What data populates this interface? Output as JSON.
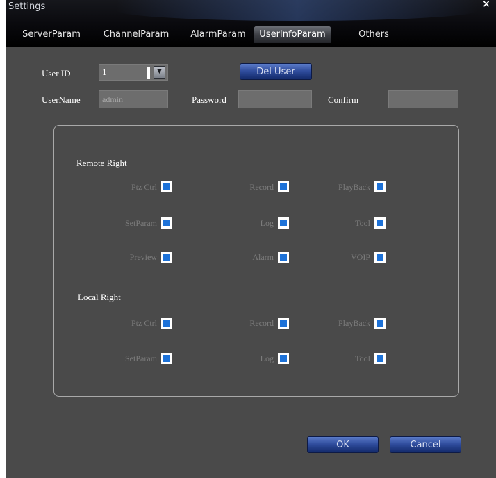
{
  "window": {
    "title": "Settings",
    "close_glyph": "×"
  },
  "tabs": [
    {
      "label": "ServerParam",
      "active": false
    },
    {
      "label": "ChannelParam",
      "active": false
    },
    {
      "label": "AlarmParam",
      "active": false
    },
    {
      "label": "UserInfoParam",
      "active": true
    },
    {
      "label": "Others",
      "active": false
    }
  ],
  "form": {
    "user_id_label": "User ID",
    "user_id_value": "1",
    "del_user_label": "Del User",
    "username_label": "UserName",
    "username_value": "admin",
    "password_label": "Password",
    "password_value": "",
    "confirm_label": "Confirm",
    "confirm_value": ""
  },
  "remote_right": {
    "title": "Remote Right",
    "items": [
      {
        "label": "Ptz Ctrl",
        "checked": true
      },
      {
        "label": "Record",
        "checked": true
      },
      {
        "label": "PlayBack",
        "checked": true
      },
      {
        "label": "SetParam",
        "checked": true
      },
      {
        "label": "Log",
        "checked": true
      },
      {
        "label": "Tool",
        "checked": true
      },
      {
        "label": "Preview",
        "checked": true
      },
      {
        "label": "Alarm",
        "checked": true
      },
      {
        "label": "VOIP",
        "checked": true
      }
    ]
  },
  "local_right": {
    "title": "Local Right",
    "items": [
      {
        "label": "Ptz Ctrl",
        "checked": true
      },
      {
        "label": "Record",
        "checked": true
      },
      {
        "label": "PlayBack",
        "checked": true
      },
      {
        "label": "SetParam",
        "checked": true
      },
      {
        "label": "Log",
        "checked": true
      },
      {
        "label": "Tool",
        "checked": true
      }
    ]
  },
  "footer": {
    "ok_label": "OK",
    "cancel_label": "Cancel"
  },
  "colors": {
    "window_bg": "#4a4a4a",
    "checkbox_fill": "#1d72d8",
    "button_blue": "#2d4a9a",
    "disabled_text": "#7c7c7c"
  }
}
